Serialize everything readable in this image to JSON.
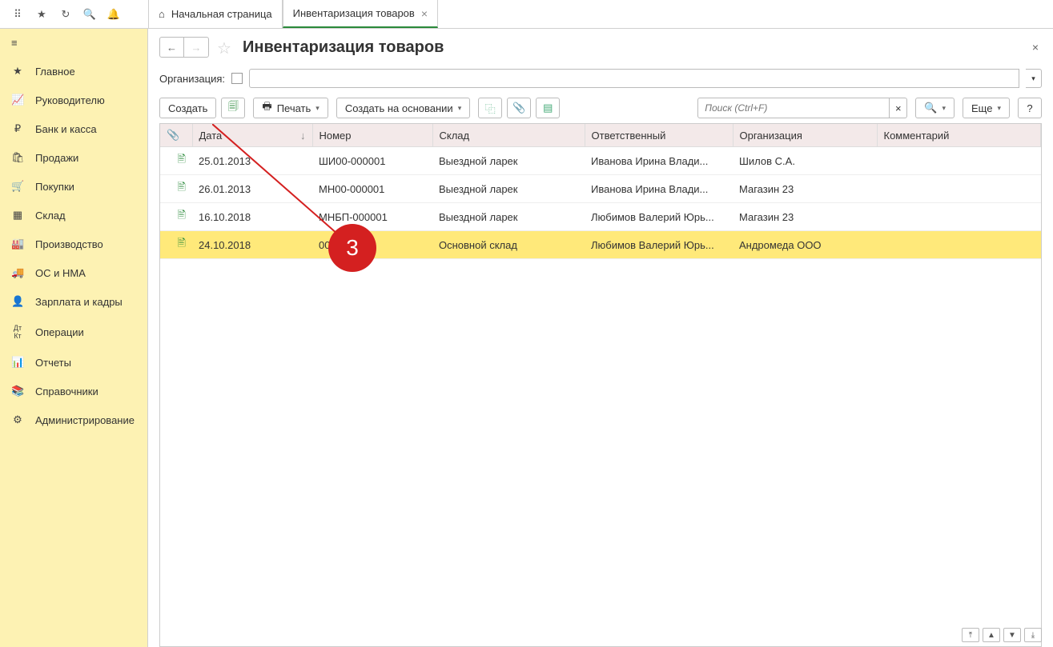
{
  "tabs": {
    "home": "Начальная страница",
    "active": "Инвентаризация товаров"
  },
  "sidebar": {
    "items": [
      "Главное",
      "Руководителю",
      "Банк и касса",
      "Продажи",
      "Покупки",
      "Склад",
      "Производство",
      "ОС и НМА",
      "Зарплата и кадры",
      "Операции",
      "Отчеты",
      "Справочники",
      "Администрирование"
    ]
  },
  "page": {
    "title": "Инвентаризация товаров"
  },
  "org": {
    "label": "Организация:"
  },
  "toolbar": {
    "create": "Создать",
    "print": "Печать",
    "create_based": "Создать на основании",
    "more": "Еще",
    "help": "?",
    "search_placeholder": "Поиск (Ctrl+F)"
  },
  "table": {
    "headers": {
      "date": "Дата",
      "number": "Номер",
      "warehouse": "Склад",
      "responsible": "Ответственный",
      "organization": "Организация",
      "comment": "Комментарий"
    },
    "rows": [
      {
        "date": "25.01.2013",
        "number": "ШИ00-000001",
        "warehouse": "Выездной ларек",
        "responsible": "Иванова Ирина Влади...",
        "organization": "Шилов С.А."
      },
      {
        "date": "26.01.2013",
        "number": "МН00-000001",
        "warehouse": "Выездной ларек",
        "responsible": "Иванова Ирина Влади...",
        "organization": "Магазин 23"
      },
      {
        "date": "16.10.2018",
        "number": "МНБП-000001",
        "warehouse": "Выездной ларек",
        "responsible": "Любимов Валерий Юрь...",
        "organization": "Магазин 23"
      },
      {
        "date": "24.10.2018",
        "number": "001",
        "warehouse": "Основной склад",
        "responsible": "Любимов Валерий Юрь...",
        "organization": "Андромеда ООО"
      }
    ]
  },
  "annotation": {
    "number": "3"
  }
}
